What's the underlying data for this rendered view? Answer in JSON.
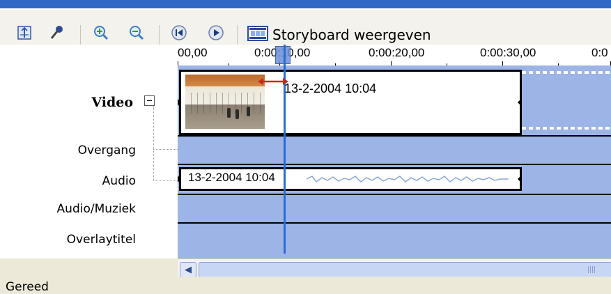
{
  "toolbar": {
    "buttons": [
      {
        "name": "narrate-timeline",
        "icon": "timeline-narration-icon"
      },
      {
        "name": "audio-levels",
        "icon": "audio-levels-icon"
      },
      {
        "name": "zoom-in",
        "icon": "zoom-in-icon"
      },
      {
        "name": "zoom-out",
        "icon": "zoom-out-icon"
      },
      {
        "name": "rewind",
        "icon": "rewind-icon"
      },
      {
        "name": "play",
        "icon": "play-icon"
      }
    ],
    "storyboard_label": "Storyboard weergeven"
  },
  "ruler": {
    "labels": [
      "00,00",
      "0:00:10,00",
      "0:00:20,00",
      "0:00:30,00",
      "0:0"
    ]
  },
  "tracks": {
    "video": "Video",
    "transition": "Overgang",
    "audio": "Audio",
    "audio_music": "Audio/Muziek",
    "overlay_title": "Overlaytitel"
  },
  "clips": {
    "video_title": "13-2-2004 10:04",
    "audio_title": "13-2-2004 10:04"
  },
  "status": {
    "text": "Gereed"
  },
  "colors": {
    "title_bar": "#3169c6",
    "track_bg": "#9db4e6",
    "playhead": "#2b6bd1",
    "trim_arrow": "#c8281e"
  }
}
